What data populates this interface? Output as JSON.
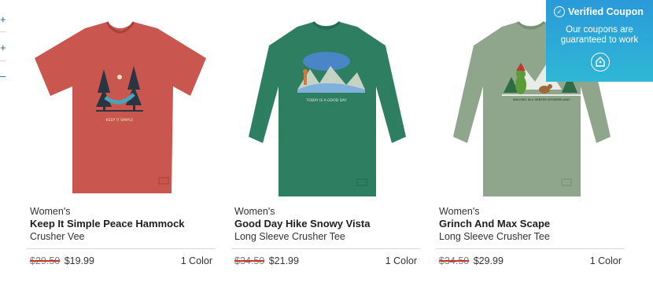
{
  "edge_controls": [
    {
      "label": "+"
    },
    {
      "label": "+"
    },
    {
      "label": "–"
    }
  ],
  "products": [
    {
      "category": "Women's",
      "name": "Keep It Simple Peace Hammock",
      "style": "Crusher Vee",
      "old_price": "$29.50",
      "price": "$19.99",
      "colors": "1 Color",
      "image": {
        "garment": "vneck-tee",
        "color": "#c9564f",
        "graphic_text": "KEEP IT SIMPLE"
      }
    },
    {
      "category": "Women's",
      "name": "Good Day Hike Snowy Vista",
      "style": "Long Sleeve Crusher Tee",
      "old_price": "$34.50",
      "price": "$21.99",
      "colors": "1 Color",
      "image": {
        "garment": "longsleeve-tee",
        "color": "#2e7f62",
        "graphic_text": "TODAY IS A GOOD DAY"
      }
    },
    {
      "category": "Women's",
      "name": "Grinch And Max Scape",
      "style": "Long Sleeve Crusher Tee",
      "old_price": "$34.50",
      "price": "$29.99",
      "colors": "1 Color",
      "image": {
        "garment": "longsleeve-tee",
        "color": "#8fa58c",
        "graphic_text": "WALKING IN A WINTER WONDERLAND"
      }
    }
  ],
  "coupon": {
    "title": "Verified Coupon",
    "line1": "Our coupons are",
    "line2": "guaranteed to work",
    "icon": "coupon-tag-icon",
    "accent": "#2a9ad8"
  }
}
